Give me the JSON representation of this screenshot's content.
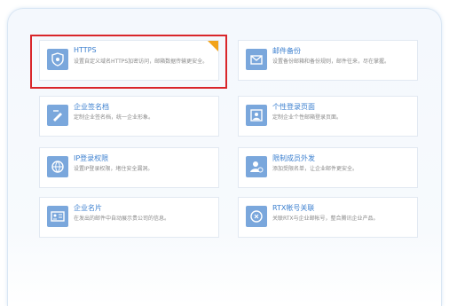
{
  "cards": [
    {
      "title": "HTTPS",
      "desc": "设置自定义域名HTTPS加密访问，邮箱数据传输更安全。",
      "icon": "shield-icon",
      "badge_color": "#f2a31a"
    },
    {
      "title": "邮件备份",
      "desc": "设置备份邮箱和备份规则，邮件往来，尽在掌握。",
      "icon": "mail-icon"
    },
    {
      "title": "企业签名档",
      "desc": "定制企业签名档，统一企业形象。",
      "icon": "signature-icon"
    },
    {
      "title": "个性登录页面",
      "desc": "定制企业个性邮箱登录页面。",
      "icon": "login-page-icon"
    },
    {
      "title": "IP登录权限",
      "desc": "设置IP登录权限，堵住安全漏洞。",
      "icon": "ip-icon"
    },
    {
      "title": "限制成员外发",
      "desc": "添加受限名单，让企业邮件更安全。",
      "icon": "restrict-icon"
    },
    {
      "title": "企业名片",
      "desc": "在发出的邮件中自动展示贵公司的信息。",
      "icon": "business-card-icon"
    },
    {
      "title": "RTX帐号关联",
      "desc": "关联RTX与企业邮帐号，整合腾讯企业产品。",
      "icon": "rtx-icon"
    }
  ],
  "colors": {
    "accent": "#3b7fcf",
    "icon_bg": "#7aa7dc",
    "highlight": "#d9262b"
  }
}
